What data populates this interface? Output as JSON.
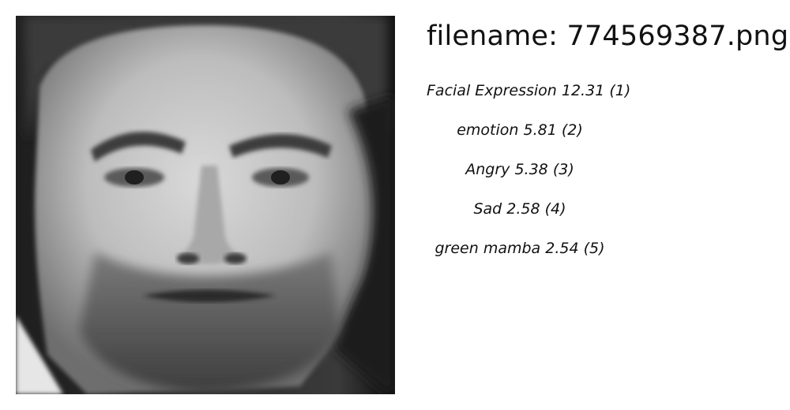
{
  "filename_line": "filename: 774569387.png",
  "image": {
    "alt": "grayscale close-up of a bearded man's face with a frowning expression"
  },
  "predictions": [
    {
      "label": "Facial Expression",
      "score": "12.31",
      "rank": "(1)"
    },
    {
      "label": "emotion",
      "score": "5.81",
      "rank": "(2)"
    },
    {
      "label": "Angry",
      "score": "5.38",
      "rank": "(3)"
    },
    {
      "label": "Sad",
      "score": "2.58",
      "rank": "(4)"
    },
    {
      "label": "green mamba",
      "score": "2.54",
      "rank": "(5)"
    }
  ]
}
